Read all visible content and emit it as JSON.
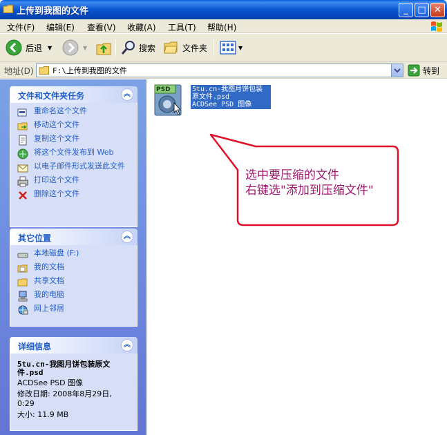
{
  "window": {
    "title": "上传到我图的文件"
  },
  "menu": {
    "items": [
      "文件(F)",
      "编辑(E)",
      "查看(V)",
      "收藏(A)",
      "工具(T)",
      "帮助(H)"
    ]
  },
  "toolbar": {
    "back_label": "后退",
    "search_label": "搜索",
    "folders_label": "文件夹"
  },
  "address": {
    "label": "地址(D)",
    "value": "F:\\上传到我图的文件",
    "go_label": "转到"
  },
  "tasks_panel": {
    "title": "文件和文件夹任务",
    "items": [
      {
        "label": "重命名这个文件",
        "icon": "rename-icon"
      },
      {
        "label": "移动这个文件",
        "icon": "move-icon"
      },
      {
        "label": "复制这个文件",
        "icon": "copy-icon"
      },
      {
        "label": "将这个文件发布到 Web",
        "icon": "publish-web-icon"
      },
      {
        "label": "以电子邮件形式发送此文件",
        "icon": "email-icon"
      },
      {
        "label": "打印这个文件",
        "icon": "print-icon"
      },
      {
        "label": "删除这个文件",
        "icon": "delete-icon"
      }
    ]
  },
  "places_panel": {
    "title": "其它位置",
    "items": [
      {
        "label": "本地磁盘 (F:)",
        "icon": "disk-icon"
      },
      {
        "label": "我的文档",
        "icon": "my-documents-icon"
      },
      {
        "label": "共享文档",
        "icon": "shared-documents-icon"
      },
      {
        "label": "我的电脑",
        "icon": "my-computer-icon"
      },
      {
        "label": "网上邻居",
        "icon": "network-icon"
      }
    ]
  },
  "details_panel": {
    "title": "详细信息",
    "name": "5tu.cn-我图月饼包装原文件.psd",
    "type": "ACDSee PSD 图像",
    "modified": "修改日期: 2008年8月29日, 0:29",
    "size": "大小: 11.9 MB"
  },
  "file": {
    "icon_label": "PSD",
    "name_line1": "5tu.cn-我图月饼包装",
    "name_line2": "原文件.psd",
    "type": "ACDSee PSD 图像"
  },
  "callout": {
    "line1": "选中要压缩的文件",
    "line2": "右键选\"添加到压缩文件\""
  },
  "colors": {
    "titlebar": "#0a56d0",
    "panel_bg": "#d6dff7",
    "link": "#215dc6",
    "callout_border": "#e0102a",
    "callout_text": "#a0186e",
    "selection": "#316ac5"
  }
}
